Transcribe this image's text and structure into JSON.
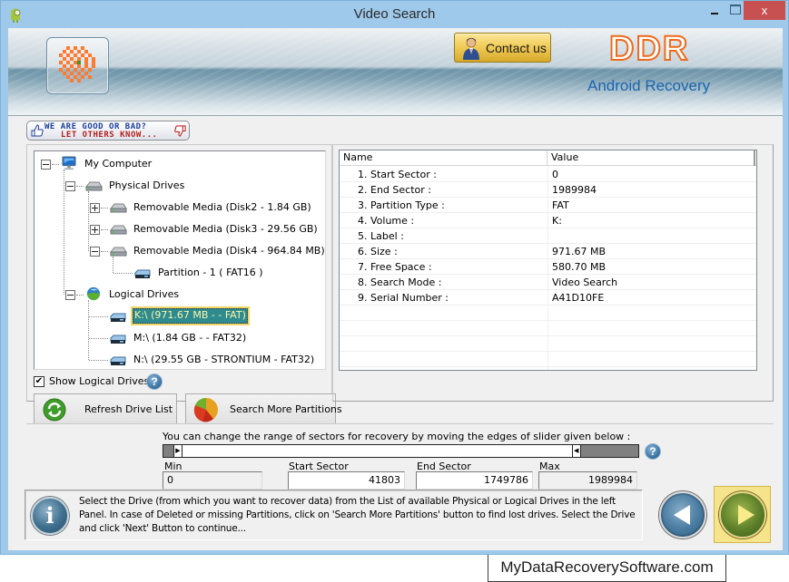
{
  "window": {
    "title": "Video Search",
    "close_glyph": "x"
  },
  "header": {
    "contact_label": "Contact us",
    "brand_logo": "DDR",
    "brand_subtitle": "Android Recovery"
  },
  "feedback": {
    "line1": "WE ARE GOOD OR BAD?",
    "line2": "LET OTHERS KNOW..."
  },
  "tree": {
    "root": "My Computer",
    "physical": "Physical Drives",
    "physical_items": [
      "Removable Media (Disk2 - 1.84 GB)",
      "Removable Media (Disk3 - 29.56 GB)",
      "Removable Media (Disk4 - 964.84 MB)"
    ],
    "partition": "Partition - 1 ( FAT16 )",
    "logical": "Logical Drives",
    "logical_items": [
      "K:\\ (971.67 MB -  - FAT)",
      "M:\\ (1.84 GB -  - FAT32)",
      "N:\\ (29.55 GB - STRONTIUM - FAT32)"
    ],
    "selected": "K:\\ (971.67 MB -  - FAT)"
  },
  "options": {
    "show_logical_label": "Show Logical Drives",
    "show_logical_checked": true,
    "checkmark": "✔",
    "help_glyph": "?"
  },
  "buttons": {
    "refresh": "Refresh Drive List",
    "search_more": "Search More Partitions"
  },
  "details": {
    "columns": [
      "Name",
      "Value"
    ],
    "rows": [
      {
        "name": "1. Start Sector :",
        "value": "0"
      },
      {
        "name": "2. End Sector :",
        "value": "1989984"
      },
      {
        "name": "3. Partition Type :",
        "value": "FAT"
      },
      {
        "name": "4. Volume :",
        "value": "K:"
      },
      {
        "name": "5. Label :",
        "value": ""
      },
      {
        "name": "6. Size :",
        "value": "971.67 MB"
      },
      {
        "name": "7. Free Space :",
        "value": "580.70 MB"
      },
      {
        "name": "8. Search Mode :",
        "value": "Video Search"
      },
      {
        "name": "9. Serial Number :",
        "value": "A41D10FE"
      }
    ]
  },
  "range": {
    "hint": "You can change the range of sectors for recovery by moving the edges of slider given below :",
    "min_label": "Min",
    "min_value": "0",
    "start_label": "Start Sector",
    "start_value": "41803",
    "end_label": "End Sector",
    "end_value": "1749786",
    "max_label": "Max",
    "max_value": "1989984",
    "slider_start_fraction": 0.021,
    "slider_end_fraction": 0.879,
    "handle_left_glyph": "▶",
    "handle_right_glyph": "◀"
  },
  "info": {
    "icon_glyph": "i",
    "text": "Select the Drive (from which you want to recover data) from the List of available Physical or Logical Drives in the left Panel. In case of Deleted or missing Partitions, click on 'Search More Partitions' button to find lost drives. Select the Drive and click 'Next' Button to continue..."
  },
  "footer": {
    "site": "MyDataRecoverySoftware.com"
  },
  "colors": {
    "titlebar": "#9ec9ea",
    "close": "#c75050",
    "brand_orange": "#f06a1c",
    "brand_blue": "#1a66b0",
    "selected_bg": "#2e8b8f",
    "selected_text": "#fff5a8",
    "next_highlight": "#f5e48c"
  }
}
